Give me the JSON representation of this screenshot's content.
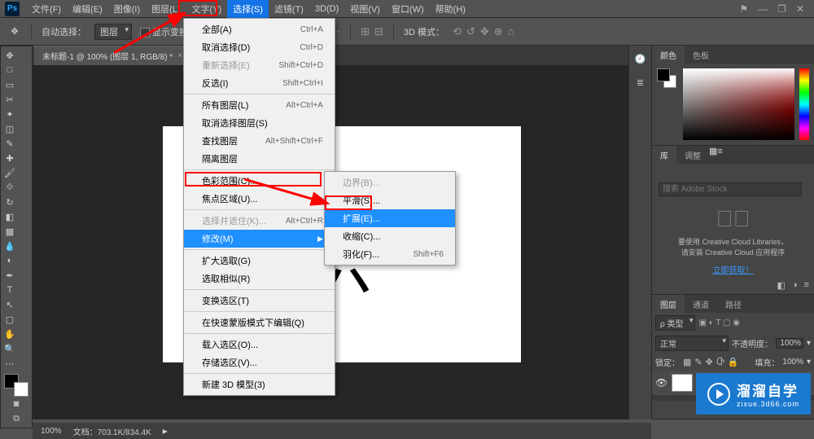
{
  "menubar": {
    "items": [
      "文件(F)",
      "编辑(E)",
      "图像(I)",
      "图层(L)",
      "文字(Y)",
      "选择(S)",
      "滤镜(T)",
      "3D(D)",
      "视图(V)",
      "窗口(W)",
      "帮助(H)"
    ],
    "active_index": 5
  },
  "window_controls": {
    "min": "—",
    "restore": "❐",
    "close": "✕"
  },
  "optionsbar": {
    "auto_select": "自动选择：",
    "layer_dd": "图层",
    "show_transform": "显示变换控件",
    "mode_label": "3D 模式："
  },
  "doctab": {
    "title": "未标题-1 @ 100% (图层 1, RGB/8) *"
  },
  "select_menu": {
    "items": [
      {
        "label": "全部(A)",
        "sc": "Ctrl+A"
      },
      {
        "label": "取消选择(D)",
        "sc": "Ctrl+D"
      },
      {
        "label": "重新选择(E)",
        "sc": "Shift+Ctrl+D",
        "dis": true
      },
      {
        "label": "反选(I)",
        "sc": "Shift+Ctrl+I"
      },
      {
        "sep": true
      },
      {
        "label": "所有图层(L)",
        "sc": "Alt+Ctrl+A"
      },
      {
        "label": "取消选择图层(S)"
      },
      {
        "label": "查找图层",
        "sc": "Alt+Shift+Ctrl+F"
      },
      {
        "label": "隔离图层"
      },
      {
        "sep": true
      },
      {
        "label": "色彩范围(C)..."
      },
      {
        "label": "焦点区域(U)..."
      },
      {
        "sep": true
      },
      {
        "label": "选择并遮住(K)...",
        "sc": "Alt+Ctrl+R",
        "dis": true
      },
      {
        "label": "修改(M)",
        "sub": true,
        "hl": true
      },
      {
        "sep": true
      },
      {
        "label": "扩大选取(G)"
      },
      {
        "label": "选取相似(R)"
      },
      {
        "sep": true
      },
      {
        "label": "变换选区(T)"
      },
      {
        "sep": true
      },
      {
        "label": "在快速蒙版模式下编辑(Q)"
      },
      {
        "sep": true
      },
      {
        "label": "载入选区(O)..."
      },
      {
        "label": "存储选区(V)..."
      },
      {
        "sep": true
      },
      {
        "label": "新建 3D 模型(3)"
      }
    ]
  },
  "modify_submenu": {
    "items": [
      {
        "label": "边界(B)...",
        "dis": true
      },
      {
        "label": "平滑(S)..."
      },
      {
        "label": "扩展(E)...",
        "hl": true
      },
      {
        "label": "收缩(C)..."
      },
      {
        "label": "羽化(F)...",
        "sc": "Shift+F6"
      }
    ]
  },
  "right": {
    "color_tab": "颜色",
    "swatches_tab": "色板",
    "lib_tab": "库",
    "adjust_tab": "调整",
    "search_ph": "搜索 Adobe Stock",
    "lib_msg1": "要使用 Creative Cloud Libraries，",
    "lib_msg2": "请安装 Creative Cloud 应用程序",
    "lib_link": "立即获取！",
    "layers_tab": "图层",
    "channels_tab": "通道",
    "paths_tab": "路径",
    "kind": "类型",
    "blend": "正常",
    "opacity_lbl": "不透明度：",
    "opacity_val": "100%",
    "lock_lbl": "锁定：",
    "fill_lbl": "填充：",
    "fill_val": "100%"
  },
  "canvas": {
    "glyph": "六"
  },
  "status": {
    "zoom": "100%",
    "docinfo": "文档：703.1K/834.4K"
  },
  "watermark": {
    "brand": "溜溜自学",
    "url": "zixue.3d66.com"
  }
}
